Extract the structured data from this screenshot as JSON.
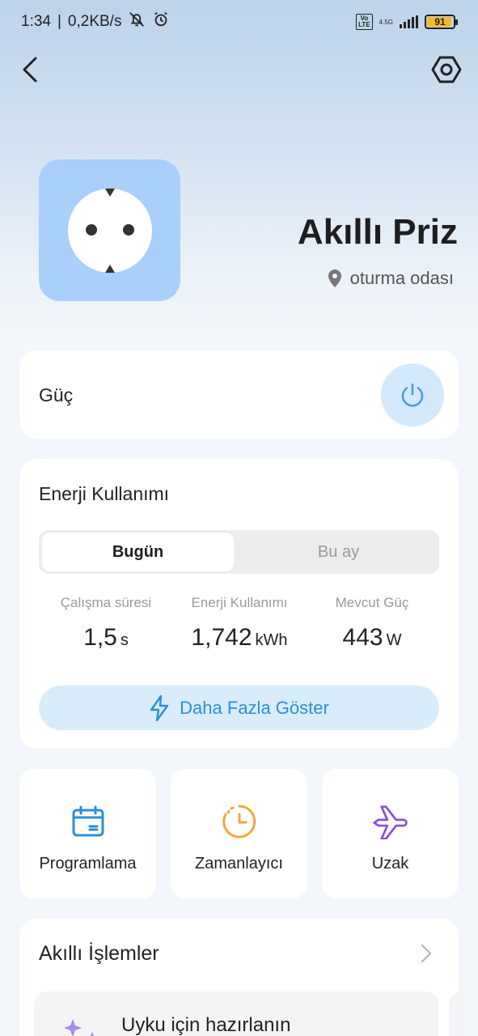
{
  "status_bar": {
    "time": "1:34",
    "speed": "0,2KB/s",
    "separator": "|",
    "volte": "Vo\nLTE",
    "network": "4.5G",
    "battery": "91"
  },
  "header": {
    "back_icon": "chevron-left-icon",
    "settings_icon": "hexagon-settings-icon"
  },
  "device": {
    "name": "Akıllı Priz",
    "location": "oturma odası",
    "tile_color": "#a8d0fb"
  },
  "power": {
    "label": "Güç",
    "icon": "power-icon",
    "accent": "#4a9fe0"
  },
  "energy": {
    "title": "Enerji Kullanımı",
    "tabs": [
      {
        "label": "Bugün",
        "selected": true
      },
      {
        "label": "Bu ay",
        "selected": false
      }
    ],
    "stats": [
      {
        "label": "Çalışma süresi",
        "value": "1,5",
        "unit": "s"
      },
      {
        "label": "Enerji Kullanımı",
        "value": "1,742",
        "unit": "kWh"
      },
      {
        "label": "Mevcut Güç",
        "value": "443",
        "unit": "W"
      }
    ],
    "more_label": "Daha Fazla Göster"
  },
  "shortcuts": [
    {
      "label": "Programlama",
      "icon": "calendar-icon",
      "color": "#2a8fd8"
    },
    {
      "label": "Zamanlayıcı",
      "icon": "clock-icon",
      "color": "#f0a93a"
    },
    {
      "label": "Uzak",
      "icon": "airplane-icon",
      "color": "#8a4fd8"
    }
  ],
  "smart_actions": {
    "title": "Akıllı İşlemler",
    "items": [
      {
        "label": "Uyku için hazırlanın",
        "icon": "sparkle-icon"
      }
    ]
  }
}
